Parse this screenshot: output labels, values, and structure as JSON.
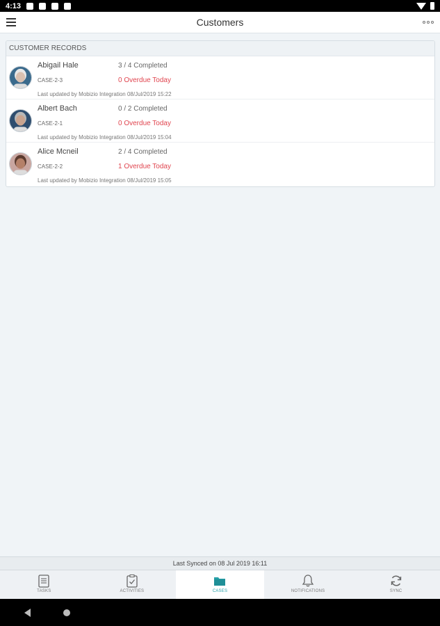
{
  "status_bar": {
    "time": "4:13",
    "left_icons": [
      "settings-icon",
      "location-icon",
      "photo-icon",
      "sd-card-icon"
    ],
    "right_icons": [
      "wifi-icon",
      "battery-icon"
    ]
  },
  "header": {
    "title": "Customers",
    "menu_icon": "hamburger-menu-icon",
    "more_icon": "more-options-icon"
  },
  "records_panel": {
    "title": "CUSTOMER RECORDS",
    "records": [
      {
        "name": "Abigail Hale",
        "case": "CASE-2-3",
        "progress": "3 / 4 Completed",
        "overdue": "0 Overdue Today",
        "updated": "Last updated by Mobizio Integration 08/Jul/2019 15:22",
        "avatar_colors": {
          "bg": "#3a6a8c",
          "face": "#d9c0b0",
          "hair": "#e8e8e8"
        }
      },
      {
        "name": "Albert Bach",
        "case": "CASE-2-1",
        "progress": "0 / 2 Completed",
        "overdue": "0 Overdue Today",
        "updated": "Last updated by Mobizio Integration 08/Jul/2019 15:04",
        "avatar_colors": {
          "bg": "#2e4d6e",
          "face": "#c9a48f",
          "hair": "#b8b8b8"
        }
      },
      {
        "name": "Alice Mcneil",
        "case": "CASE-2-2",
        "progress": "2 / 4 Completed",
        "overdue": "1 Overdue Today",
        "updated": "Last updated by Mobizio Integration 08/Jul/2019 15:05",
        "avatar_colors": {
          "bg": "#c9a6a0",
          "face": "#b58068",
          "hair": "#5a3a2e"
        }
      }
    ]
  },
  "sync_bar": {
    "text": "Last Synced on 08 Jul 2019 16:11"
  },
  "tabs": [
    {
      "label": "TASKS",
      "icon": "tasks-icon",
      "active": false
    },
    {
      "label": "ACTIVITIES",
      "icon": "activities-icon",
      "active": false
    },
    {
      "label": "CASES",
      "icon": "cases-folder-icon",
      "active": true
    },
    {
      "label": "NOTIFICATIONS",
      "icon": "bell-icon",
      "active": false
    },
    {
      "label": "SYNC",
      "icon": "sync-icon",
      "active": false
    }
  ],
  "colors": {
    "accent": "#26a0a8",
    "overdue": "#e0454f",
    "background": "#f0f4f7"
  }
}
